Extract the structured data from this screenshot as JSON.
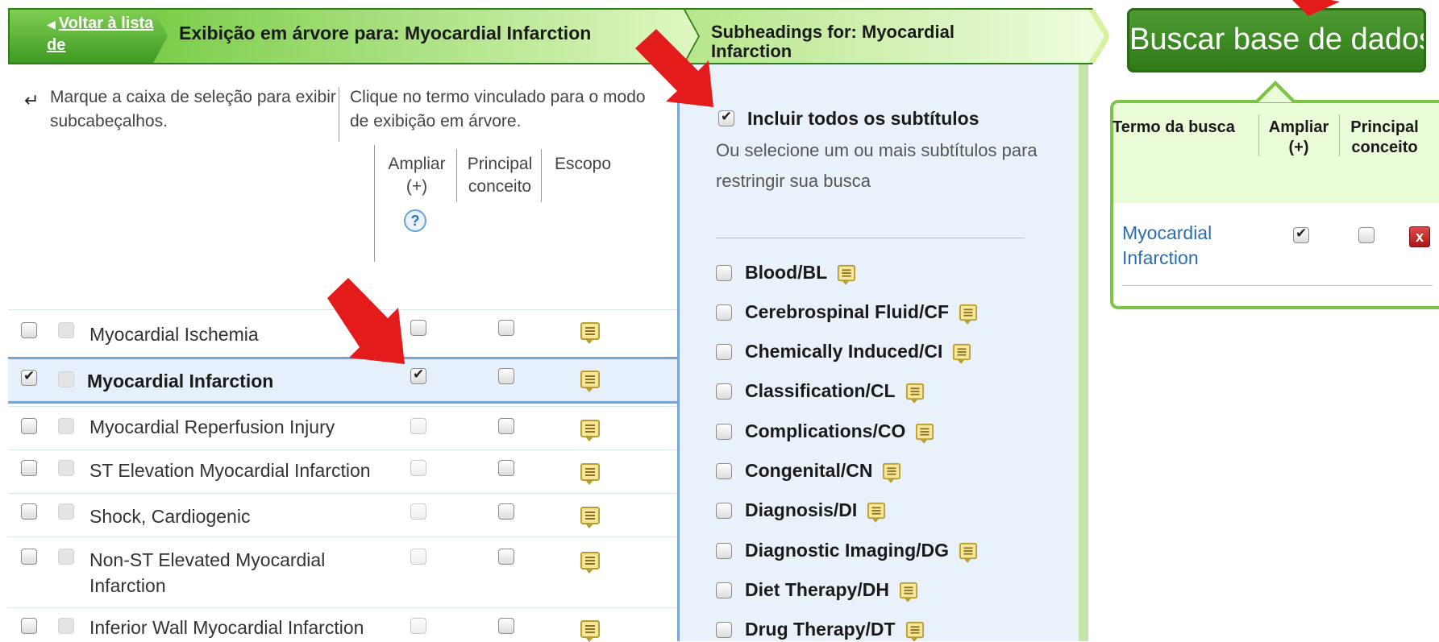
{
  "header": {
    "back_link": "Voltar à lista de",
    "tree_title": "Exibição em árvore para: Myocardial Infarction",
    "subheadings_title": "Subheadings for: Myocardial Infarction"
  },
  "instructions": {
    "left": "Marque a caixa de seleção para exibir subcabeçalhos.",
    "right": "Clique no termo vinculado para o modo de exibição em árvore."
  },
  "columns": {
    "expand": "Ampliar (+)",
    "main": "Principal conceito",
    "scope": "Escopo",
    "help": "?"
  },
  "terms": [
    {
      "label": "Myocardial Ischemia",
      "checked": false,
      "expand_checked": false,
      "expand_enabled": true,
      "selected": false
    },
    {
      "label": "Myocardial Infarction",
      "checked": true,
      "expand_checked": true,
      "expand_enabled": true,
      "selected": true
    },
    {
      "label": "Myocardial Reperfusion Injury",
      "checked": false,
      "expand_checked": false,
      "expand_enabled": false,
      "selected": false
    },
    {
      "label": "ST Elevation Myocardial Infarction",
      "checked": false,
      "expand_checked": false,
      "expand_enabled": false,
      "selected": false
    },
    {
      "label": "Shock, Cardiogenic",
      "checked": false,
      "expand_checked": false,
      "expand_enabled": false,
      "selected": false
    },
    {
      "label": "Non-ST Elevated Myocardial Infarction",
      "checked": false,
      "expand_checked": false,
      "expand_enabled": false,
      "selected": false
    },
    {
      "label": "Inferior Wall Myocardial Infarction",
      "checked": false,
      "expand_checked": false,
      "expand_enabled": false,
      "selected": false
    }
  ],
  "subheadings": {
    "include_all_label": "Incluir todos os subtítulos",
    "include_all_checked": true,
    "description": "Ou selecione um ou mais subtítulos para restringir sua busca",
    "items": [
      "Blood/BL",
      "Cerebrospinal Fluid/CF",
      "Chemically Induced/CI",
      "Classification/CL",
      "Complications/CO",
      "Congenital/CN",
      "Diagnosis/DI",
      "Diagnostic Imaging/DG",
      "Diet Therapy/DH",
      "Drug Therapy/DT"
    ]
  },
  "search_panel": {
    "button_label": "Buscar base de dados",
    "col_term": "Termo da busca",
    "col_expand": "Ampliar (+)",
    "col_main": "Principal conceito",
    "term": "Myocardial Infarction",
    "expand_checked": true,
    "main_checked": false,
    "remove": "x"
  },
  "colors": {
    "banner_green": "#9ed86c",
    "banner_light": "#e4fbc8",
    "button_green": "#3f8a26",
    "panel_blue": "#e9f2fb",
    "link_blue": "#2a6db5",
    "arrow_red": "#e31b1b"
  }
}
